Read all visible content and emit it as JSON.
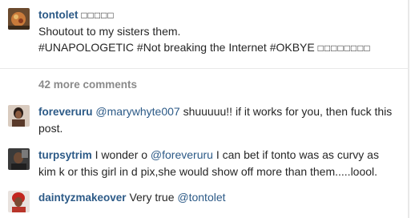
{
  "caption": {
    "username": "tontolet",
    "emoji_after_name": "□□□□□",
    "line1": "Shoutout to my sisters them.",
    "line2": "#UNAPOLOGETIC #Not breaking the Internet #OKBYE",
    "emoji_after_text": "□□□□□□□□"
  },
  "more_comments": "42 more comments",
  "comments": [
    {
      "username": "foreveruru",
      "mention": "@marywhyte007",
      "text": " shuuuuu!! if it works for you, then fuck this post."
    },
    {
      "username": "turpsytrim",
      "text_before": " I wonder o ",
      "mention": "@foreveruru",
      "text_after": " I can bet if tonto was as curvy as kim k or this girl in d pix,she would show off more than them.....loool."
    },
    {
      "username": "daintyzmakeover",
      "text_before": " Very true ",
      "mention": "@tontolet"
    }
  ],
  "colors": {
    "username": "#2c5a87",
    "mention": "#3897f0",
    "muted": "#8a8a8a",
    "text": "#262626"
  }
}
